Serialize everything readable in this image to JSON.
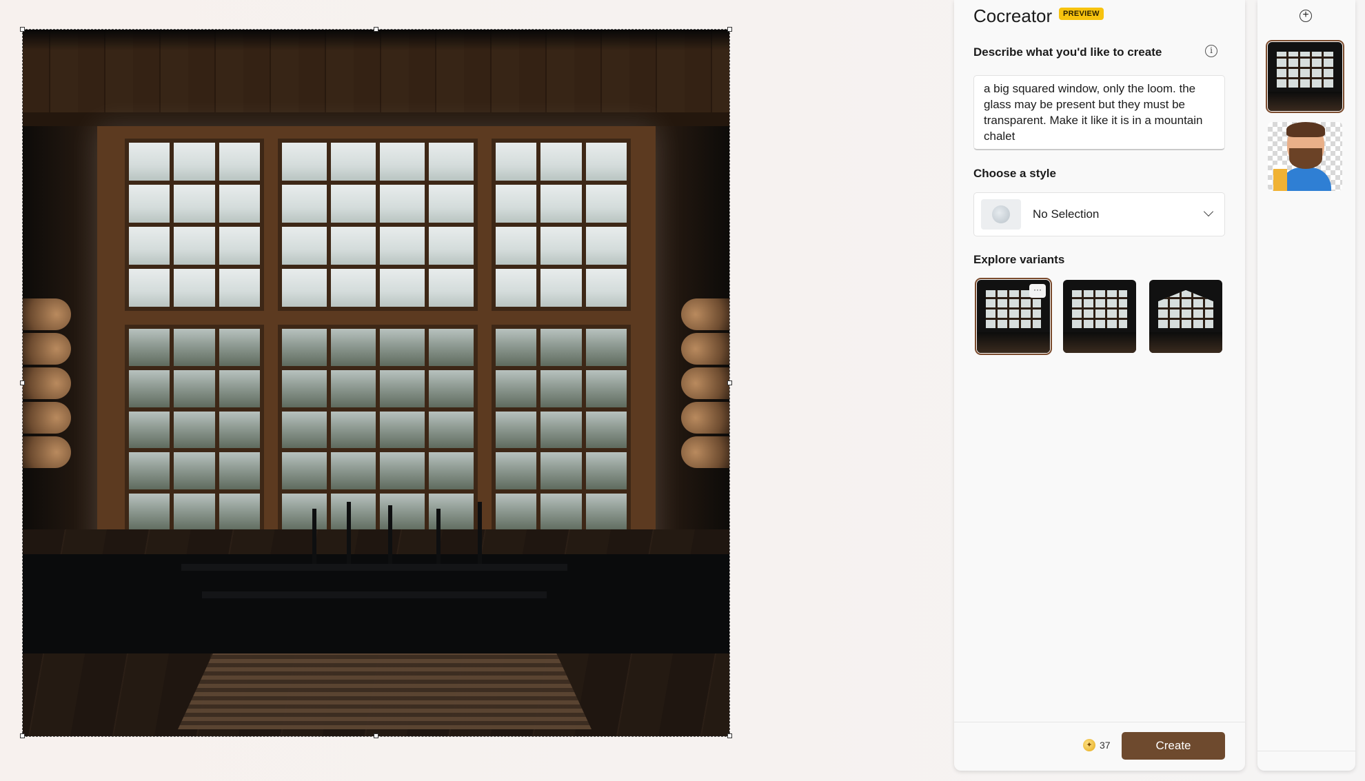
{
  "cocreator": {
    "title": "Cocreator",
    "badge": "PREVIEW",
    "describe_label": "Describe what you'd like to create",
    "prompt_text": "a big squared window, only the loom. the glass may be present but they must be transparent. Make it like it is in a mountain chalet",
    "style_label": "Choose a style",
    "style_value": "No Selection",
    "variants_label": "Explore variants",
    "variants_selected_index": 0,
    "more_glyph": "···",
    "credits": "37",
    "create_label": "Create"
  },
  "icons": {
    "info": "i",
    "add_layer": "+",
    "credit": "✦"
  },
  "colors": {
    "accent": "#6e4a2e",
    "badge": "#f7c30f"
  }
}
